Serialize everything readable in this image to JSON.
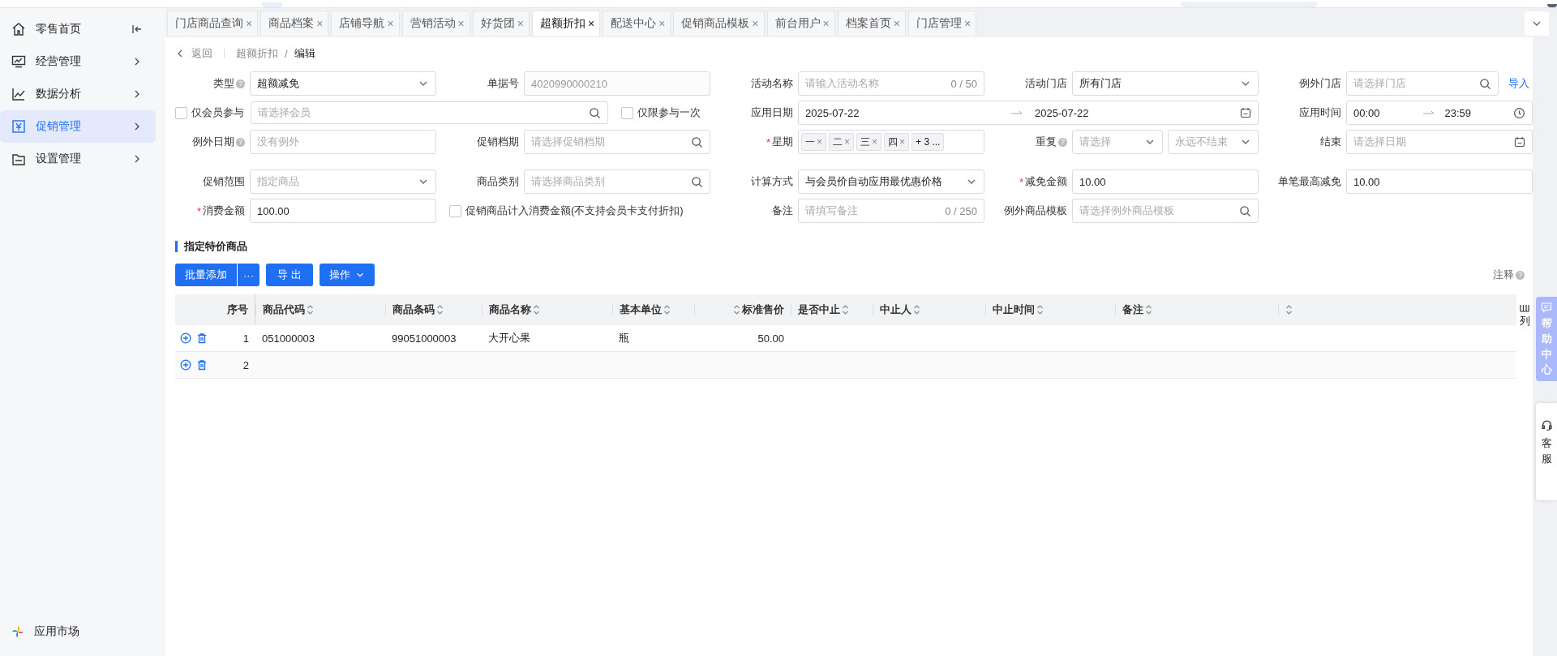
{
  "sidebar": {
    "items": [
      {
        "label": "零售首页",
        "selected": false
      },
      {
        "label": "经营管理",
        "selected": false,
        "expanded": false
      },
      {
        "label": "数据分析",
        "selected": false,
        "expanded": false
      },
      {
        "label": "促销管理",
        "selected": true,
        "expanded": false
      },
      {
        "label": "设置管理",
        "selected": false,
        "expanded": false
      }
    ],
    "footer": {
      "label": "应用市场"
    }
  },
  "tabs": [
    {
      "label": "门店商品查询",
      "close": "×",
      "selected": false
    },
    {
      "label": "商品档案",
      "close": "×",
      "selected": false
    },
    {
      "label": "店铺导航",
      "close": "×",
      "selected": false
    },
    {
      "label": "营销活动",
      "close": "×",
      "selected": false
    },
    {
      "label": "好货团",
      "close": "×",
      "selected": false
    },
    {
      "label": "超额折扣",
      "close": "×",
      "selected": true
    },
    {
      "label": "配送中心",
      "close": "×",
      "selected": false
    },
    {
      "label": "促销商品模板",
      "close": "×",
      "selected": false
    },
    {
      "label": "前台用户",
      "close": "×",
      "selected": false
    },
    {
      "label": "档案首页",
      "close": "×",
      "selected": false
    },
    {
      "label": "门店管理",
      "close": "×",
      "selected": false
    }
  ],
  "breadcrumb": {
    "back": "返回",
    "path": [
      "超额折扣",
      "编辑"
    ],
    "separator": "/"
  },
  "form": {
    "fields": [
      {
        "kind": "select",
        "label": "类型",
        "help": "?",
        "value": "超额减免"
      },
      {
        "kind": "input",
        "label": "单据号",
        "value": "4020990000210",
        "disabled": true
      },
      {
        "kind": "counter",
        "label": "活动名称",
        "placeholder": "请输入活动名称",
        "count": "0 / 50"
      },
      {
        "kind": "select",
        "label": "活动门店",
        "value": "所有门店"
      },
      {
        "kind": "search",
        "label": "例外门店",
        "placeholder": "请选择门店",
        "link": "导入"
      },
      {
        "kind": "member",
        "checkbox": {
          "label": "仅会员参与",
          "checked": false
        },
        "placeholder": "请选择会员"
      },
      {
        "kind": "once",
        "label": "仅限参与一次",
        "checked": false
      },
      {
        "kind": "daterange",
        "label": "应用日期",
        "start": "2025-07-22",
        "end": "2025-07-22"
      },
      {
        "kind": "timerange",
        "label": "应用时间",
        "start": "00:00",
        "end": "23:59"
      },
      {
        "kind": "input",
        "label": "例外日期",
        "help": "?",
        "placeholder": "没有例外"
      },
      {
        "kind": "search",
        "label": "促销档期",
        "placeholder": "请选择促销档期"
      },
      {
        "kind": "tags",
        "label": "星期",
        "required_mark": "*",
        "tags": [
          {
            "label": "一",
            "close": "×"
          },
          {
            "label": "二",
            "close": "×"
          },
          {
            "label": "三",
            "close": "×"
          },
          {
            "label": "四",
            "close": "×"
          }
        ],
        "more": "+ 3 ..."
      },
      {
        "kind": "split",
        "label": "重复",
        "help": "?",
        "first": "请选择",
        "second": "永远不结束"
      },
      {
        "kind": "date",
        "label": "结束",
        "placeholder": "请选择日期"
      },
      {
        "kind": "select",
        "label": "促销范围",
        "placeholder": "指定商品"
      },
      {
        "kind": "search",
        "label": "商品类别",
        "placeholder": "请选择商品类别"
      },
      {
        "kind": "select",
        "label": "计算方式",
        "value": "与会员价自动应用最优惠价格"
      },
      {
        "kind": "input",
        "label": "减免金额",
        "required_mark": "*",
        "value": "10.00"
      },
      {
        "kind": "input",
        "label": "单笔最高减免",
        "value": "10.00"
      },
      {
        "kind": "input",
        "label": "消费金额",
        "required_mark": "*",
        "value": "100.00"
      },
      {
        "kind": "checkbox",
        "label": "促销商品计入消费金额(不支持会员卡支付折扣)",
        "checked": false
      },
      {
        "kind": "counter",
        "label": "备注",
        "placeholder": "请填写备注",
        "count": "0 / 250"
      },
      {
        "kind": "search",
        "label": "例外商品模板",
        "placeholder": "请选择例外商品模板"
      }
    ]
  },
  "section": {
    "title": "指定特价商品"
  },
  "toolbar": {
    "batch_add": "批量添加",
    "more": "···",
    "export": "导 出",
    "operate": "操作",
    "note": "注释",
    "note_help": "?"
  },
  "table": {
    "columns": [
      {
        "label": "序号",
        "sortable": false
      },
      {
        "label": "商品代码",
        "sortable": true
      },
      {
        "label": "商品条码",
        "sortable": true
      },
      {
        "label": "商品名称",
        "sortable": true
      },
      {
        "label": "基本单位",
        "sortable": true
      },
      {
        "label": "标准售价",
        "sortable": true
      },
      {
        "label": "是否中止",
        "sortable": true
      },
      {
        "label": "中止人",
        "sortable": true
      },
      {
        "label": "中止时间",
        "sortable": true
      },
      {
        "label": "备注",
        "sortable": true
      },
      {
        "sortable": true
      }
    ],
    "rows": [
      {
        "cells": [
          "1",
          "051000003",
          "99051000003",
          "大开心果",
          "瓶",
          "50.00"
        ]
      },
      {
        "cells": [
          "2"
        ]
      }
    ],
    "column_settings": "列"
  },
  "float": {
    "help_center": "帮助中心",
    "service": "客服"
  }
}
